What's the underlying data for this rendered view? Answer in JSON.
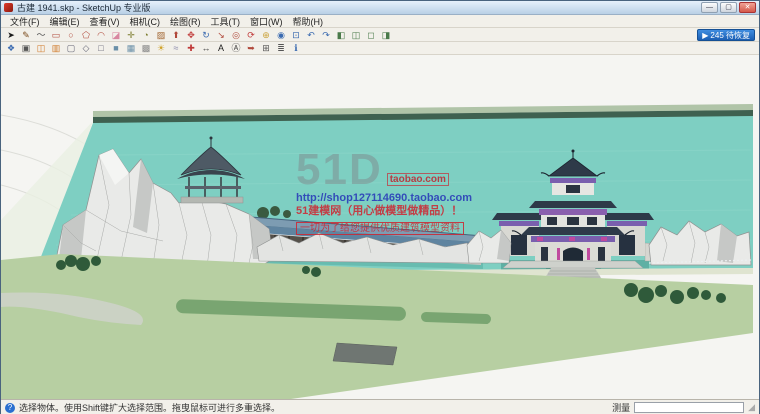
{
  "window": {
    "title": "古建 1941.skp - SketchUp 专业版",
    "controls": {
      "minimize": "—",
      "maximize": "▢",
      "close": "✕"
    }
  },
  "menu": {
    "items": [
      "文件(F)",
      "编辑(E)",
      "查看(V)",
      "相机(C)",
      "绘图(R)",
      "工具(T)",
      "窗口(W)",
      "帮助(H)"
    ]
  },
  "toolbars": {
    "row1": [
      {
        "name": "select-tool",
        "glyph": "➤",
        "color": "#1a1a1a"
      },
      {
        "name": "line-tool",
        "glyph": "✎",
        "color": "#7a4a1a"
      },
      {
        "name": "freehand-tool",
        "glyph": "〜",
        "color": "#555555"
      },
      {
        "name": "rectangle-tool",
        "glyph": "▭",
        "color": "#b0483a"
      },
      {
        "name": "circle-tool",
        "glyph": "○",
        "color": "#b0483a"
      },
      {
        "name": "polygon-tool",
        "glyph": "⬠",
        "color": "#b0483a"
      },
      {
        "name": "arc-tool",
        "glyph": "◠",
        "color": "#b0483a"
      },
      {
        "name": "eraser-tool",
        "glyph": "◪",
        "color": "#d886a0"
      },
      {
        "name": "tape-measure-tool",
        "glyph": "✛",
        "color": "#7a7a2a"
      },
      {
        "name": "protractor-tool",
        "glyph": "◔",
        "color": "#7a7a2a"
      },
      {
        "name": "paint-bucket-tool",
        "glyph": "▨",
        "color": "#a0622d"
      },
      {
        "name": "push-pull-tool",
        "glyph": "⬆",
        "color": "#b0483a"
      },
      {
        "name": "move-tool",
        "glyph": "✥",
        "color": "#c03a3a"
      },
      {
        "name": "rotate-tool",
        "glyph": "↻",
        "color": "#3a6ab0"
      },
      {
        "name": "scale-tool",
        "glyph": "↘",
        "color": "#b0483a"
      },
      {
        "name": "offset-tool",
        "glyph": "◎",
        "color": "#b0483a"
      },
      {
        "name": "orbit-tool",
        "glyph": "⟳",
        "color": "#c03a3a"
      },
      {
        "name": "pan-tool",
        "glyph": "⊕",
        "color": "#caa23a"
      },
      {
        "name": "zoom-tool",
        "glyph": "◉",
        "color": "#3a6ab0"
      },
      {
        "name": "zoom-extents-tool",
        "glyph": "⊡",
        "color": "#3a6ab0"
      },
      {
        "name": "previous-view",
        "glyph": "↶",
        "color": "#3a6ab0"
      },
      {
        "name": "next-view",
        "glyph": "↷",
        "color": "#3a6ab0"
      },
      {
        "name": "iso-view",
        "glyph": "◧",
        "color": "#4a7a4a"
      },
      {
        "name": "top-view",
        "glyph": "◫",
        "color": "#4a7a4a"
      },
      {
        "name": "front-view",
        "glyph": "◻",
        "color": "#4a7a4a"
      },
      {
        "name": "right-view",
        "glyph": "◨",
        "color": "#4a7a4a"
      }
    ],
    "row2": [
      {
        "name": "make-component",
        "glyph": "❖",
        "color": "#3a6ab0"
      },
      {
        "name": "make-group",
        "glyph": "▣",
        "color": "#555555"
      },
      {
        "name": "section-plane",
        "glyph": "◫",
        "color": "#d07a2a"
      },
      {
        "name": "section-fill",
        "glyph": "▥",
        "color": "#d07a2a"
      },
      {
        "name": "xray-style",
        "glyph": "▢",
        "color": "#666677"
      },
      {
        "name": "wireframe-style",
        "glyph": "◇",
        "color": "#666677"
      },
      {
        "name": "hidden-line-style",
        "glyph": "□",
        "color": "#666677"
      },
      {
        "name": "shaded-style",
        "glyph": "■",
        "color": "#6a8fa8"
      },
      {
        "name": "textured-style",
        "glyph": "▦",
        "color": "#6a8fa8"
      },
      {
        "name": "monochrome-style",
        "glyph": "▩",
        "color": "#888888"
      },
      {
        "name": "shadows-toggle",
        "glyph": "☀",
        "color": "#d0a22a"
      },
      {
        "name": "fog-toggle",
        "glyph": "≈",
        "color": "#8888aa"
      },
      {
        "name": "axes-tool",
        "glyph": "✚",
        "color": "#c03a3a"
      },
      {
        "name": "dimension-tool",
        "glyph": "↔",
        "color": "#444444"
      },
      {
        "name": "text-tool",
        "glyph": "A",
        "color": "#222222"
      },
      {
        "name": "3d-text-tool",
        "glyph": "Ⓐ",
        "color": "#444444"
      },
      {
        "name": "follow-me-tool",
        "glyph": "➥",
        "color": "#b0483a"
      },
      {
        "name": "intersect-tool",
        "glyph": "⊞",
        "color": "#555555"
      },
      {
        "name": "layers-panel",
        "glyph": "≣",
        "color": "#555555"
      },
      {
        "name": "model-info",
        "glyph": "ℹ",
        "color": "#3a6ab0"
      }
    ]
  },
  "notification": {
    "icon": "▶",
    "text": "245 待恢复"
  },
  "watermark": {
    "brand": "51D",
    "brand_suffix": "taobao.com",
    "url": "http://shop127114690.taobao.com",
    "line1": "51建模网（用心做模型做精品）！",
    "line2": "一切为了给您提供优质建筑模型资料"
  },
  "statusbar": {
    "help_glyph": "?",
    "hint": "选择物体。使用Shift键扩大选择范围。拖曳鼠标可进行多重选择。",
    "measure_label": "测量",
    "measure_value": "",
    "grip": "◢"
  },
  "scene": {
    "colors": {
      "water": "#7ecfc2",
      "water_deep": "#5fb4a8",
      "ground": "#b7cfa2",
      "far_green": "#3f6150",
      "far_light": "#a8bfa0",
      "roof_blue": "#5f84a0",
      "roof_blue_light": "#7d9cb2",
      "gate_navy": "#2e3a49",
      "purple": "#7a5fae",
      "magenta": "#c04a9e",
      "rock": "#e9eae8",
      "rock_dark": "#c6c8c6",
      "bush": "#2f5a3a",
      "hedge": "#79a571"
    }
  }
}
